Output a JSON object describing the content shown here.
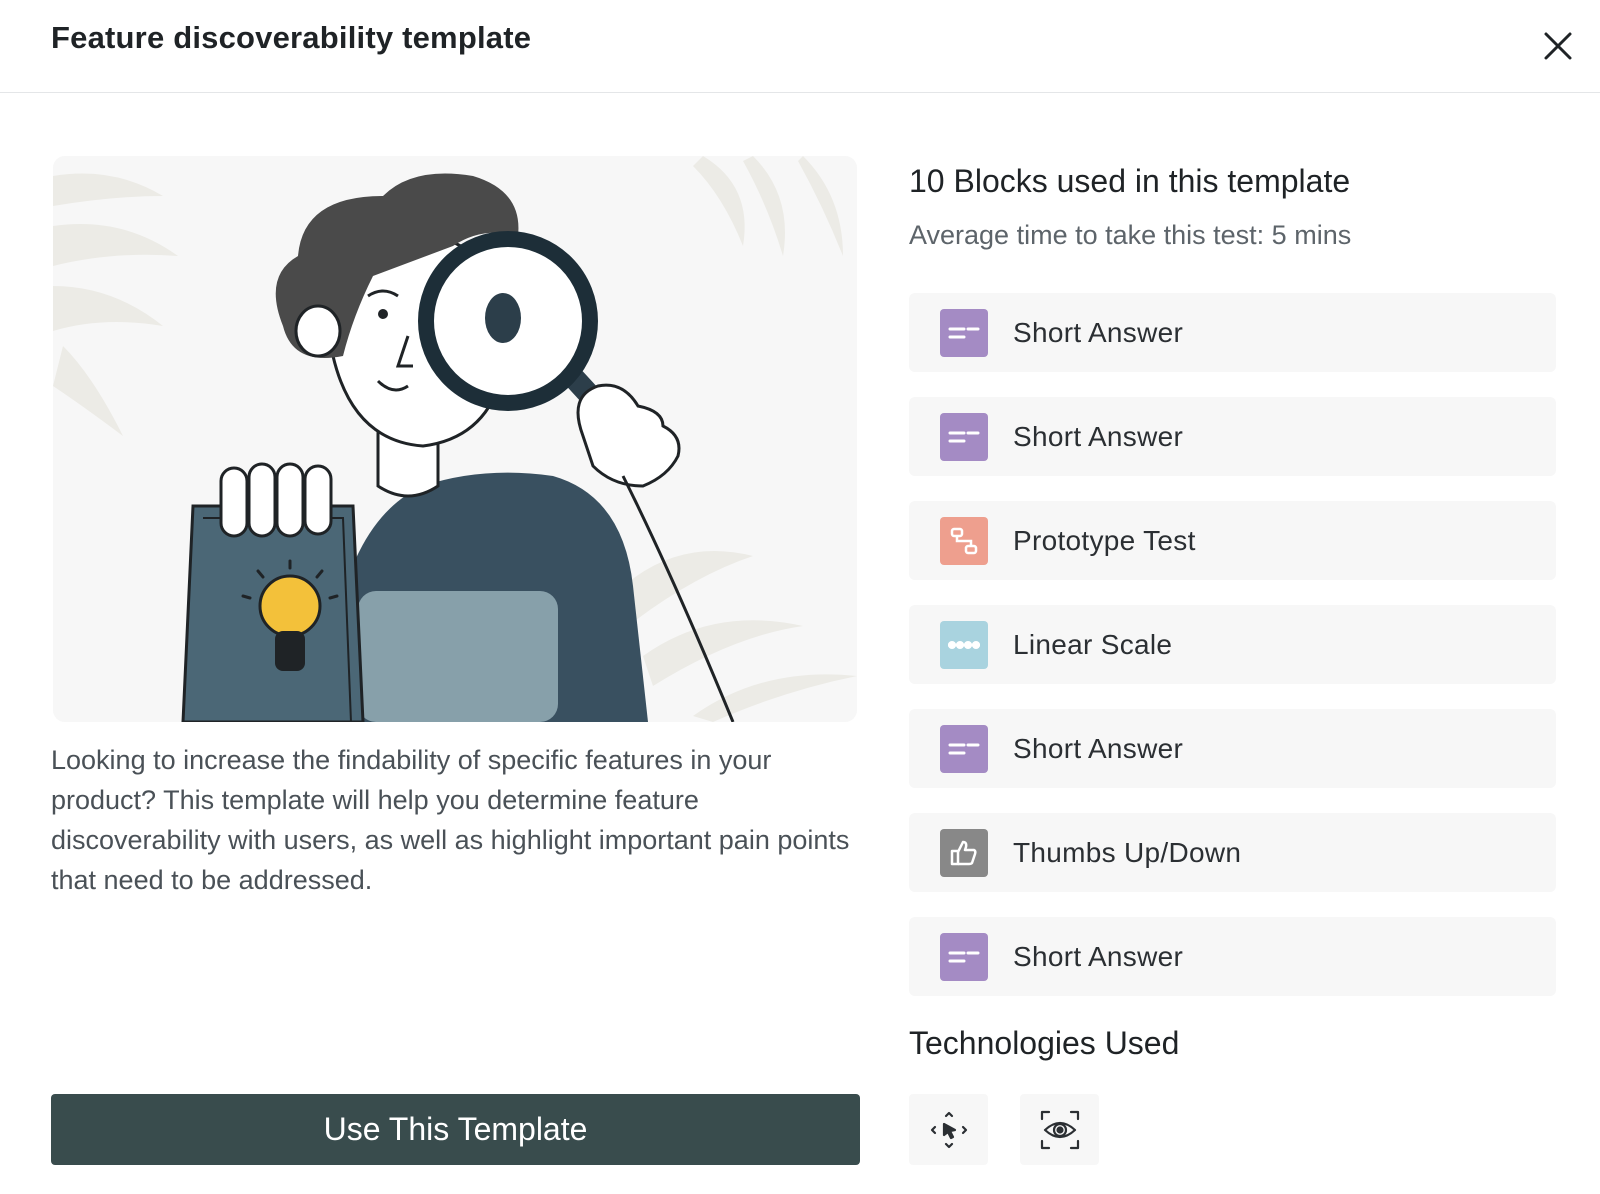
{
  "header": {
    "title": "Feature discoverability template",
    "close_icon": "close-icon"
  },
  "template": {
    "description": "Looking to increase the findability of specific features in your product? This template will help you determine feature discoverability with users, as well as highlight important pain points that need to be addressed.",
    "cta_label": "Use This Template",
    "cta_color": "#394c4d"
  },
  "blocks": {
    "title": "10 Blocks used in this template",
    "avg_time": "Average time to take this test: 5 mins",
    "items": [
      {
        "label": "Short Answer",
        "icon": "short-answer-icon",
        "color": "#a48bc4"
      },
      {
        "label": "Short Answer",
        "icon": "short-answer-icon",
        "color": "#a48bc4"
      },
      {
        "label": "Prototype Test",
        "icon": "prototype-test-icon",
        "color": "#ee9f8e"
      },
      {
        "label": "Linear Scale",
        "icon": "linear-scale-icon",
        "color": "#a9d3df"
      },
      {
        "label": "Short Answer",
        "icon": "short-answer-icon",
        "color": "#a48bc4"
      },
      {
        "label": "Thumbs Up/Down",
        "icon": "thumbs-up-icon",
        "color": "#888888"
      },
      {
        "label": "Short Answer",
        "icon": "short-answer-icon",
        "color": "#a48bc4"
      }
    ]
  },
  "technologies": {
    "title": "Technologies Used",
    "items": [
      {
        "icon": "click-tracking-icon"
      },
      {
        "icon": "eye-tracking-icon"
      }
    ]
  }
}
